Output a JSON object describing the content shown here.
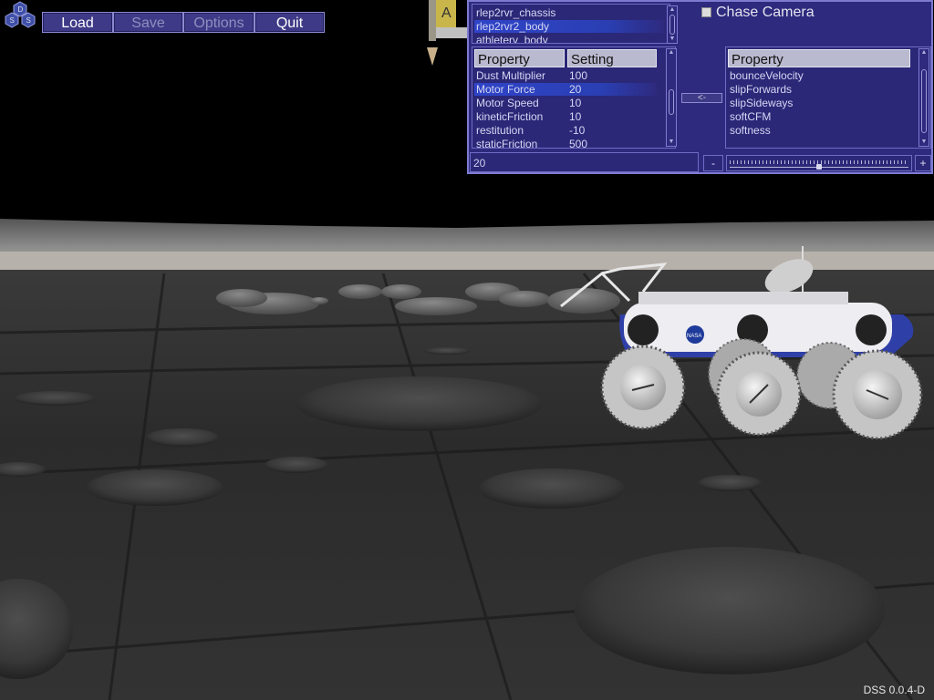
{
  "toolbar": {
    "load": "Load",
    "save": "Save",
    "options": "Options",
    "quit": "Quit"
  },
  "logo": {
    "top": "D",
    "left": "S",
    "right": "S"
  },
  "lander": {
    "label": "A"
  },
  "objects": [
    "rlep2rvr_chassis",
    "rlep2rvr2_body",
    "athleterv_body"
  ],
  "selected_object": 1,
  "params": {
    "header_property": "Property",
    "header_setting": "Setting",
    "rows": [
      {
        "property": "Dust Multiplier",
        "setting": "100"
      },
      {
        "property": "Motor Force",
        "setting": "20"
      },
      {
        "property": "Motor Speed",
        "setting": "10"
      },
      {
        "property": "kineticFriction",
        "setting": "10"
      },
      {
        "property": "restitution",
        "setting": "-10"
      },
      {
        "property": "staticFriction",
        "setting": "500"
      }
    ],
    "selected_row": 1
  },
  "chase_camera": {
    "label": "Chase Camera",
    "checked": false
  },
  "move_button": "<-",
  "available": {
    "header": "Property",
    "items": [
      "bounceVelocity",
      "slipForwards",
      "slipSideways",
      "softCFM",
      "softness"
    ]
  },
  "value_field": "20",
  "slider": {
    "minus": "-",
    "plus": "+",
    "level": 0.5
  },
  "version": "DSS 0.0.4-D",
  "rover_badge": "NASA"
}
